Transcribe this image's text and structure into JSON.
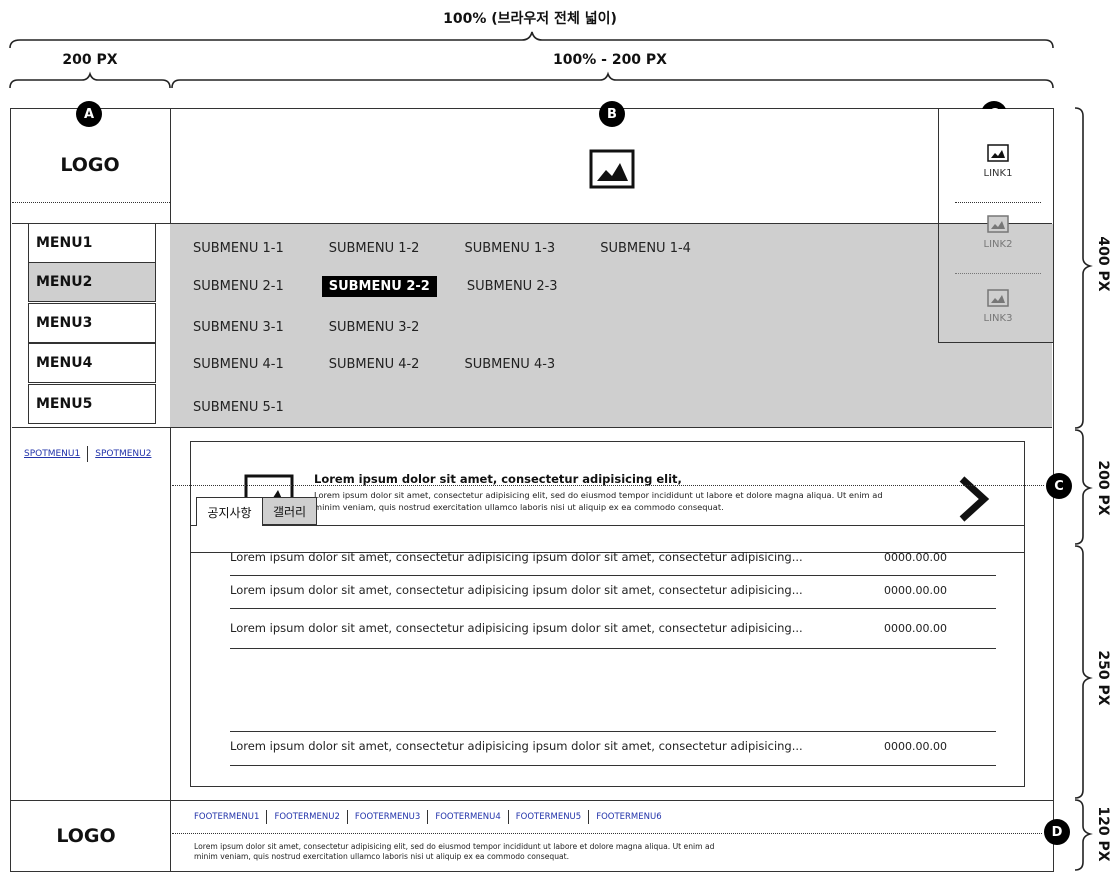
{
  "dimensions": {
    "total_width": "100% (브라우저 전체 넓이)",
    "left_width": "200 PX",
    "right_width": "100% - 200 PX",
    "height_top": "400 PX",
    "height_banner": "200 PX",
    "height_board": "250 PX",
    "height_footer": "120 PX"
  },
  "markers": {
    "a": "A",
    "b": "B",
    "c": "C",
    "c2": "C",
    "d": "D"
  },
  "header": {
    "logo": "LOGO",
    "banner_image_icon": "image-icon"
  },
  "quick_links": [
    {
      "label": "LINK1",
      "icon": "image-icon"
    },
    {
      "label": "LINK2",
      "icon": "image-icon"
    },
    {
      "label": "LINK3",
      "icon": "image-icon"
    }
  ],
  "menu": {
    "items": [
      "MENU1",
      "MENU2",
      "MENU3",
      "MENU4",
      "MENU5"
    ],
    "active_index": 1
  },
  "submenus": [
    [
      "SUBMENU 1-1",
      "SUBMENU 1-2",
      "SUBMENU 1-3",
      "SUBMENU 1-4"
    ],
    [
      "SUBMENU 2-1",
      "SUBMENU 2-2",
      "SUBMENU 2-3"
    ],
    [
      "SUBMENU 3-1",
      "SUBMENU 3-2"
    ],
    [
      "SUBMENU 4-1",
      "SUBMENU 4-2",
      "SUBMENU 4-3"
    ],
    [
      "SUBMENU 5-1"
    ]
  ],
  "active_submenu": "SUBMENU 2-2",
  "spot_menu": [
    "SPOTMENU1",
    "SPOTMENU2"
  ],
  "banner": {
    "title": "Lorem ipsum dolor sit amet, consectetur adipisicing elit,",
    "body_line1": "Lorem ipsum dolor sit amet, consectetur adipisicing elit, sed do eiusmod tempor incididunt ut labore et dolore magna aliqua. Ut enim ad",
    "body_line2": "minim veniam, quis nostrud exercitation ullamco laboris nisi ut aliquip ex ea commodo consequat.",
    "next_icon": "chevron-right-icon"
  },
  "board": {
    "tabs": [
      "공지사항",
      "갤러리"
    ],
    "rows": [
      {
        "title": "Lorem ipsum dolor sit amet, consectetur adipisicing ipsum dolor sit amet, consectetur adipisicing...",
        "date": "0000.00.00"
      },
      {
        "title": "Lorem ipsum dolor sit amet, consectetur adipisicing ipsum dolor sit amet, consectetur adipisicing...",
        "date": "0000.00.00"
      },
      {
        "title": "Lorem ipsum dolor sit amet, consectetur adipisicing ipsum dolor sit amet, consectetur adipisicing...",
        "date": "0000.00.00"
      },
      {
        "title": "Lorem ipsum dolor sit amet, consectetur adipisicing ipsum dolor sit amet, consectetur adipisicing...",
        "date": "0000.00.00"
      }
    ]
  },
  "footer": {
    "logo": "LOGO",
    "menu": [
      "FOOTERMENU1",
      "FOOTERMENU2",
      "FOOTERMENU3",
      "FOOTERMENU4",
      "FOOTERMENU5",
      "FOOTERMENU6"
    ],
    "text_line1": "Lorem ipsum dolor sit amet, consectetur adipisicing elit, sed do eiusmod tempor incididunt ut labore et dolore magna aliqua. Ut enim ad",
    "text_line2": "minim veniam, quis nostrud exercitation ullamco laboris nisi ut aliquip ex ea commodo consequat."
  },
  "colors": {
    "menu_band": "#cfcfcf",
    "active_submenu_bg": "#000000",
    "link_blue": "#2233aa"
  }
}
